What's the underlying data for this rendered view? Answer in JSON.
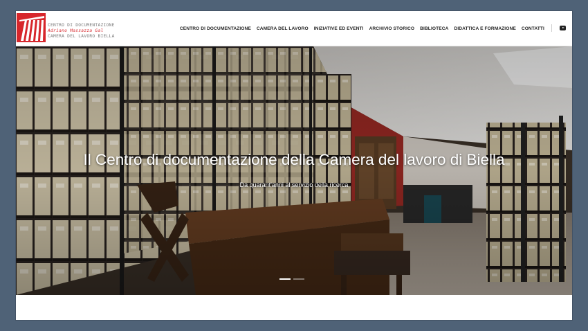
{
  "logo": {
    "line1": "CENTRO DI DOCUMENTAZIONE",
    "line2": "Adriano Massazza Gal",
    "line3": "CAMERA DEL LAVORO BIELLA"
  },
  "nav": {
    "items": [
      "CENTRO DI DOCUMENTAZIONE",
      "CAMERA DEL LAVORO",
      "INIZIATIVE ED EVENTI",
      "ARCHIVIO STORICO",
      "BIBLIOTECA",
      "DIDATTICA E FORMAZIONE",
      "CONTATTI"
    ]
  },
  "social": {
    "icon": "youtube-icon"
  },
  "hero": {
    "title": "Il Centro di documentazione della Camera del lavoro di Biella",
    "subtitle": "Da quarant'anni al servizio della ricerca",
    "slides_total": 2,
    "active_slide": 1
  },
  "colors": {
    "page_background": "#4f6277",
    "logo_red": "#d7262b",
    "nav_text": "#222222",
    "hero_text": "#ffffff"
  }
}
